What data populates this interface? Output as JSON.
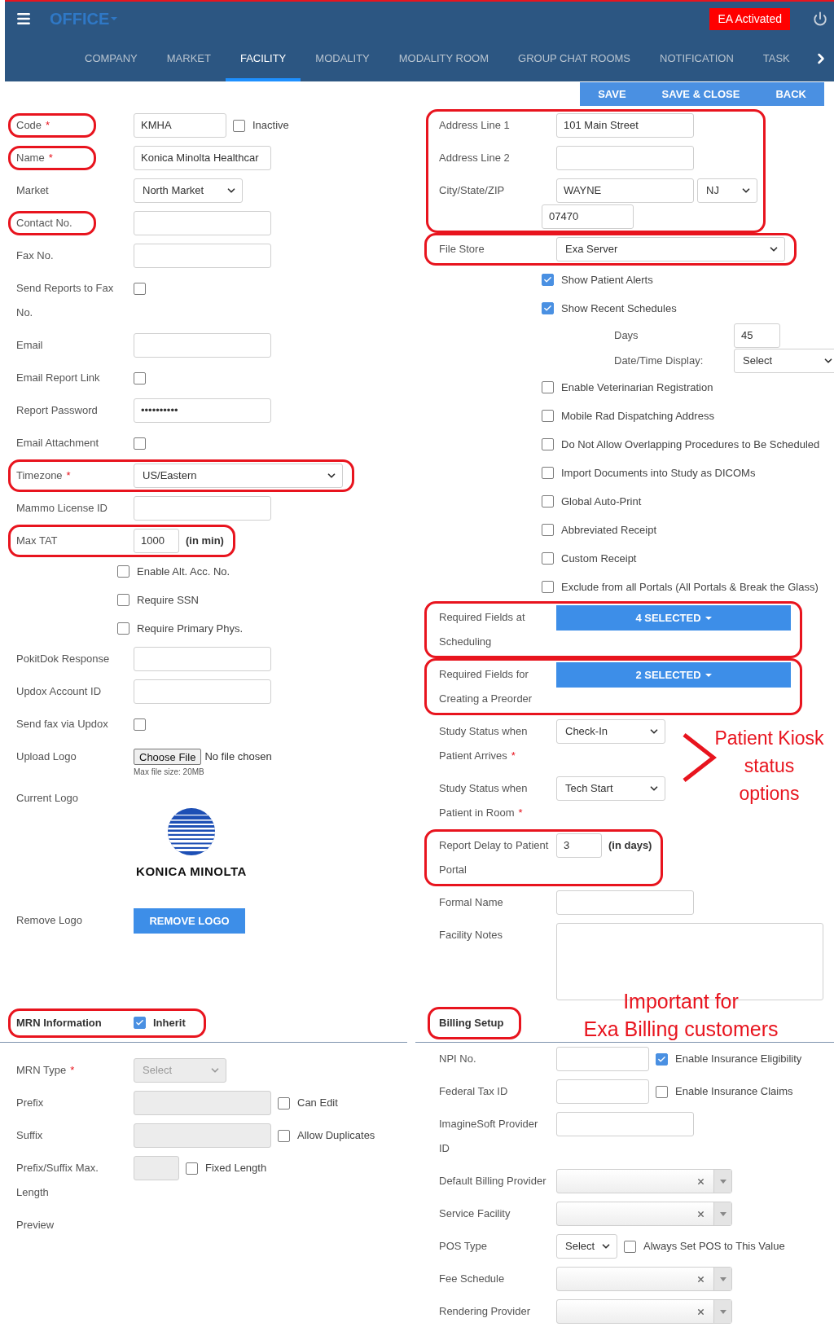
{
  "header": {
    "title": "OFFICE",
    "badge": "EA Activated"
  },
  "tabs": [
    {
      "label": "COMPANY",
      "selected": false
    },
    {
      "label": "MARKET",
      "selected": false
    },
    {
      "label": "FACILITY",
      "selected": true
    },
    {
      "label": "MODALITY",
      "selected": false
    },
    {
      "label": "MODALITY ROOM",
      "selected": false
    },
    {
      "label": "GROUP CHAT ROOMS",
      "selected": false
    },
    {
      "label": "NOTIFICATION",
      "selected": false
    },
    {
      "label": "TASK",
      "selected": false
    }
  ],
  "actions": [
    "SAVE",
    "SAVE & CLOSE",
    "BACK"
  ],
  "left": [
    {
      "kind": "mid_text",
      "label": "Code",
      "required_mark": "*",
      "label_outlined": true,
      "value": "KMHA",
      "check": {
        "label": "Inactive",
        "checked": false
      }
    },
    {
      "kind": "text",
      "label": "Name",
      "required_mark": "*",
      "label_outlined": true,
      "value": "Konica Minolta Healthcar"
    },
    {
      "kind": "select",
      "label": "Market",
      "value": "North Market"
    },
    {
      "kind": "text",
      "label": "Contact No.",
      "label_outlined": true
    },
    {
      "kind": "text",
      "label": "Fax No."
    },
    {
      "kind": "check",
      "label": "Send Reports to Fax\nNo.",
      "checked": false
    },
    {
      "kind": "text",
      "label": "Email"
    },
    {
      "kind": "check",
      "label": "Email Report Link",
      "checked": false
    },
    {
      "kind": "text",
      "label": "Report Password",
      "value": "••••••••••"
    },
    {
      "kind": "check",
      "label": "Email Attachment",
      "checked": false
    },
    {
      "kind": "wide_select",
      "label": "Timezone",
      "required_mark": "*",
      "outlined": true,
      "value": "US/Eastern"
    },
    {
      "kind": "text",
      "label": "Mammo License ID"
    },
    {
      "kind": "short_text",
      "label": "Max TAT",
      "outlined": true,
      "value": "1000",
      "suffix": "(in min)"
    },
    {
      "kind": "option",
      "label": "Enable Alt. Acc. No.",
      "checked": false
    },
    {
      "kind": "option",
      "label": "Require SSN",
      "checked": false
    },
    {
      "kind": "option",
      "label": "Require Primary Phys.",
      "checked": false
    },
    {
      "kind": "text",
      "label": "PokitDok Response"
    },
    {
      "kind": "text",
      "label": "Updox Account ID"
    },
    {
      "kind": "check",
      "label": "Send fax via Updox",
      "checked": false
    },
    {
      "kind": "file",
      "label": "Upload Logo",
      "button": "Choose File",
      "status": "No file chosen",
      "note": "Max file size: 20MB"
    },
    {
      "kind": "logo",
      "label": "Current Logo",
      "logo_text": "KONICA MINOLTA"
    },
    {
      "kind": "button",
      "label": "Remove Logo",
      "button": "REMOVE LOGO"
    }
  ],
  "right": [
    {
      "kind": "address",
      "outlined": true,
      "line1_label": "Address Line 1",
      "line1": "101 Main Street",
      "line2_label": "Address Line 2",
      "city_label": "City/State/ZIP",
      "city": "WAYNE",
      "state": "NJ",
      "zip": "07470"
    },
    {
      "kind": "wide_select",
      "label": "File Store",
      "outlined": true,
      "value": "Exa Server"
    },
    {
      "kind": "option",
      "label": "Show Patient Alerts",
      "checked": true
    },
    {
      "kind": "option",
      "label": "Show Recent Schedules",
      "checked": true
    },
    {
      "kind": "sub_text",
      "label": "Days",
      "value": "45"
    },
    {
      "kind": "sub_select",
      "label": "Date/Time Display:",
      "value": "Select"
    },
    {
      "kind": "option",
      "label": "Enable Veterinarian Registration",
      "checked": false
    },
    {
      "kind": "option",
      "label": "Mobile Rad Dispatching Address",
      "checked": false
    },
    {
      "kind": "option",
      "label": "Do Not Allow Overlapping Procedures to Be Scheduled",
      "checked": false
    },
    {
      "kind": "option",
      "label": "Import Documents into Study as DICOMs",
      "checked": false
    },
    {
      "kind": "option",
      "label": "Global Auto-Print",
      "checked": false
    },
    {
      "kind": "option",
      "label": "Abbreviated Receipt",
      "checked": false
    },
    {
      "kind": "option",
      "label": "Custom Receipt",
      "checked": false
    },
    {
      "kind": "option",
      "label": "Exclude from all Portals (All Portals & Break the Glass)",
      "checked": false
    },
    {
      "kind": "multiselect",
      "label": "Required Fields at\nScheduling",
      "outlined": true,
      "value": "4 SELECTED"
    },
    {
      "kind": "multiselect",
      "label": "Required Fields for\nCreating a Preorder",
      "outlined": true,
      "value": "2 SELECTED"
    },
    {
      "kind": "select",
      "label": "Study Status when\nPatient Arrives",
      "required_mark": "*",
      "value": "Check-In"
    },
    {
      "kind": "select",
      "label": "Study Status when\nPatient in Room",
      "required_mark": "*",
      "value": "Tech Start"
    },
    {
      "kind": "short_text",
      "label": "Report Delay to Patient\nPortal",
      "outlined": true,
      "value": "3",
      "suffix": "(in days)"
    },
    {
      "kind": "text",
      "label": "Formal Name"
    },
    {
      "kind": "textarea",
      "label": "Facility Notes"
    }
  ],
  "kiosk_note": [
    "Patient Kiosk",
    "status",
    "options"
  ],
  "mrn": {
    "title": "MRN Information",
    "outlined": true,
    "inherit": {
      "label": "Inherit",
      "checked": true
    },
    "rows": [
      {
        "kind": "small_select",
        "label": "MRN Type",
        "required_mark": "*",
        "value": "Select",
        "disabled": true
      },
      {
        "kind": "text",
        "label": "Prefix",
        "disabled": true,
        "check": {
          "label": "Can Edit",
          "checked": false
        }
      },
      {
        "kind": "text",
        "label": "Suffix",
        "disabled": true,
        "check": {
          "label": "Allow Duplicates",
          "checked": false
        }
      },
      {
        "kind": "short_text",
        "label": "Prefix/Suffix Max.\nLength",
        "disabled": true,
        "check": {
          "label": "Fixed Length",
          "checked": false
        }
      },
      {
        "kind": "label",
        "label": "Preview"
      }
    ]
  },
  "billing": {
    "title": "Billing Setup",
    "outlined": true,
    "note": [
      "Important for",
      "Exa Billing customers"
    ],
    "rows": [
      {
        "kind": "mid_text",
        "label": "NPI No.",
        "check": {
          "label": "Enable Insurance Eligibility",
          "checked": true
        }
      },
      {
        "kind": "mid_text",
        "label": "Federal Tax ID",
        "check": {
          "label": "Enable Insurance Claims",
          "checked": false
        }
      },
      {
        "kind": "text",
        "label": "ImagineSoft Provider\nID"
      },
      {
        "kind": "combo",
        "label": "Default Billing Provider"
      },
      {
        "kind": "combo",
        "label": "Service Facility"
      },
      {
        "kind": "tiny_select",
        "label": "POS Type",
        "value": "Select",
        "check": {
          "label": "Always Set POS to This Value",
          "checked": false
        }
      },
      {
        "kind": "combo",
        "label": "Fee Schedule"
      },
      {
        "kind": "combo",
        "label": "Rendering Provider"
      }
    ]
  }
}
